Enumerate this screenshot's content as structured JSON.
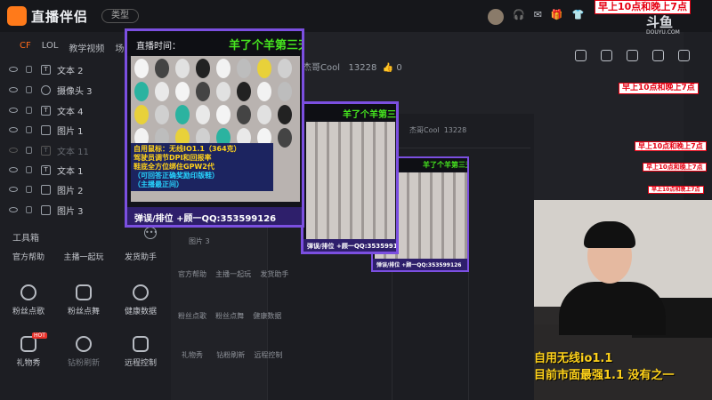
{
  "app": {
    "name": "直播伴侣",
    "type_button": "类型",
    "brand": "斗鱼",
    "brand_sub": "DOUYU.COM"
  },
  "ticker": "早上10点和晚上7点",
  "scene_tabs": [
    "CF",
    "LOL",
    "教学视频",
    "场景"
  ],
  "layers": [
    {
      "name": "文本 2",
      "type": "T"
    },
    {
      "name": "摄像头 3",
      "type": "cam"
    },
    {
      "name": "文本 4",
      "type": "T"
    },
    {
      "name": "图片 1",
      "type": "img"
    },
    {
      "name": "文本 11",
      "type": "T",
      "hidden": true
    },
    {
      "name": "文本 1",
      "type": "T"
    },
    {
      "name": "图片 2",
      "type": "img"
    },
    {
      "name": "图片 3",
      "type": "img"
    }
  ],
  "toolbox": {
    "title": "工具箱",
    "row1": [
      "官方帮助",
      "主播一起玩",
      "发货助手"
    ],
    "row2": [
      "粉丝点歌",
      "粉丝点舞",
      "健康数据"
    ],
    "row3": [
      "礼物秀",
      "钻粉刷新",
      "远程控制"
    ],
    "hot_badge": "HOT"
  },
  "fans": {
    "name": "杰哥Cool",
    "count": "13228",
    "likes": "0"
  },
  "echo_fans": {
    "name": "杰哥Cool",
    "count": "13228",
    "likes": "0"
  },
  "echo_layer": "图片 3",
  "card": {
    "label": "直播时间：",
    "title": "羊了个羊第三天",
    "desc": [
      "自用鼠标：无线IO1.1（364克）",
      "驾驶员调节DPI和回报率",
      "鞋底全方位绑住GPW2代",
      "（可回答正确奖励印版鞋）",
      "（主播最正间）"
    ],
    "footer": "弹误/排位  +顾一QQ:353599126"
  },
  "cam_lines": [
    "自用无线io1.1",
    "目前市面最强1.1 没有之一"
  ],
  "colors": {
    "accent": "#ff6a1a",
    "card_border": "#7b4fe0",
    "title_green": "#46e51f",
    "desc_yellow": "#ffd21a",
    "ticker_red": "#e60012"
  }
}
